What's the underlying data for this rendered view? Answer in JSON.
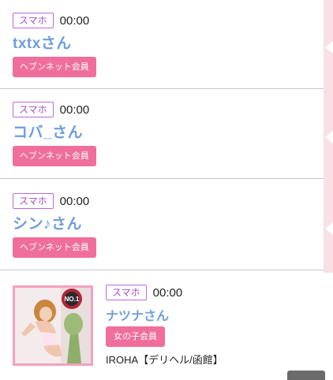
{
  "items": [
    {
      "device": "スマホ",
      "time": "00:00",
      "name": "txtxさん",
      "member_label": "ヘブンネット会員"
    },
    {
      "device": "スマホ",
      "time": "00:00",
      "name": "コバ_さん",
      "member_label": "ヘブンネット会員"
    },
    {
      "device": "スマホ",
      "time": "00:00",
      "name": "シン♪さん",
      "member_label": "ヘブンネット会員"
    }
  ],
  "featured": {
    "device": "スマホ",
    "time": "00:00",
    "name": "ナツナさん",
    "member_label": "女の子会員",
    "shop": "IROHA【デリヘル/函館】",
    "thumb_badge_text": "NO.1"
  },
  "colors": {
    "name": "#6f9ddd",
    "badge_border": "#b86cd6",
    "member_button": "#f06e9c",
    "side_strip": "#f7e1e4"
  }
}
